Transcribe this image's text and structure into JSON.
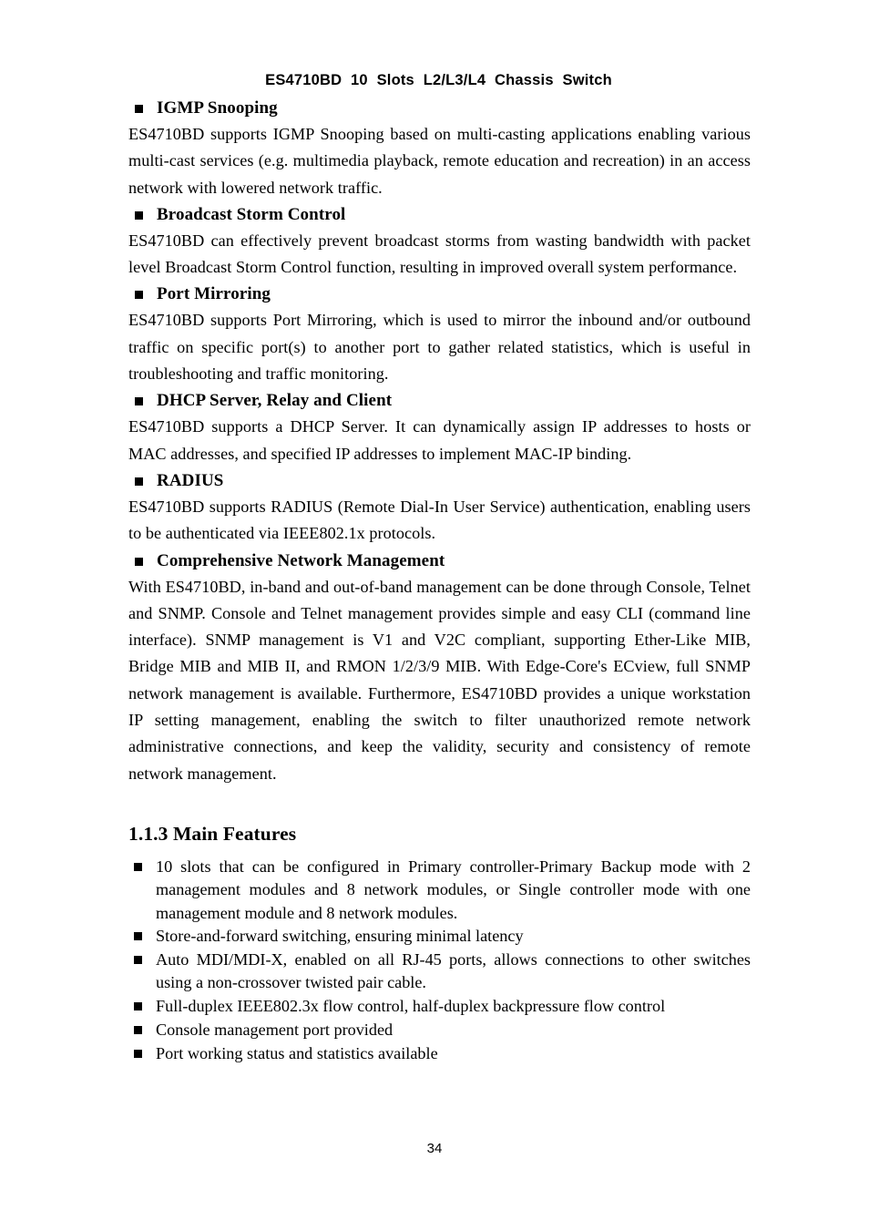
{
  "header": {
    "title": "ES4710BD  10  Slots  L2/L3/L4  Chassis  Switch"
  },
  "sections": [
    {
      "heading": "IGMP Snooping",
      "body": "ES4710BD supports IGMP Snooping based on multi-casting applications enabling various multi-cast services (e.g. multimedia playback, remote education and recreation) in an access network with lowered network traffic."
    },
    {
      "heading": "Broadcast Storm Control",
      "body": "ES4710BD can effectively prevent broadcast storms from wasting bandwidth with packet level Broadcast Storm Control function, resulting in improved overall system performance."
    },
    {
      "heading": "Port Mirroring",
      "body": "ES4710BD supports Port Mirroring, which is used to mirror the inbound and/or outbound traffic on specific port(s) to another port to gather related statistics, which is useful in troubleshooting and traffic monitoring."
    },
    {
      "heading": "DHCP Server, Relay and Client",
      "body": "ES4710BD supports a DHCP Server. It can dynamically assign IP addresses to hosts or MAC addresses, and specified IP addresses to implement MAC-IP binding."
    },
    {
      "heading": "RADIUS",
      "body": "ES4710BD supports RADIUS (Remote Dial-In User Service) authentication, enabling users to be authenticated via IEEE802.1x protocols."
    },
    {
      "heading": "Comprehensive Network Management",
      "body": "With ES4710BD, in-band and out-of-band management can be done through Console, Telnet and SNMP. Console and Telnet management provides simple and easy CLI (command line interface). SNMP management is V1 and V2C compliant, supporting Ether-Like MIB, Bridge MIB and MIB II, and RMON 1/2/3/9 MIB. With Edge-Core's ECview, full SNMP network management is available. Furthermore, ES4710BD provides a unique workstation IP setting management, enabling the switch to filter unauthorized remote network administrative connections, and keep the validity, security and consistency of remote network management."
    }
  ],
  "main_features": {
    "heading": "1.1.3 Main Features",
    "items": [
      "10 slots that can be configured in Primary controller-Primary Backup mode with 2 management modules and 8 network modules, or Single controller mode with one management module and 8 network modules.",
      "Store-and-forward switching, ensuring minimal latency",
      "Auto MDI/MDI-X, enabled on all RJ-45 ports, allows connections to other switches using a non-crossover twisted pair cable.",
      "Full-duplex IEEE802.3x flow control, half-duplex backpressure flow control",
      "Console management port provided",
      "Port working status and statistics available"
    ]
  },
  "footer": {
    "page_number": "34"
  }
}
